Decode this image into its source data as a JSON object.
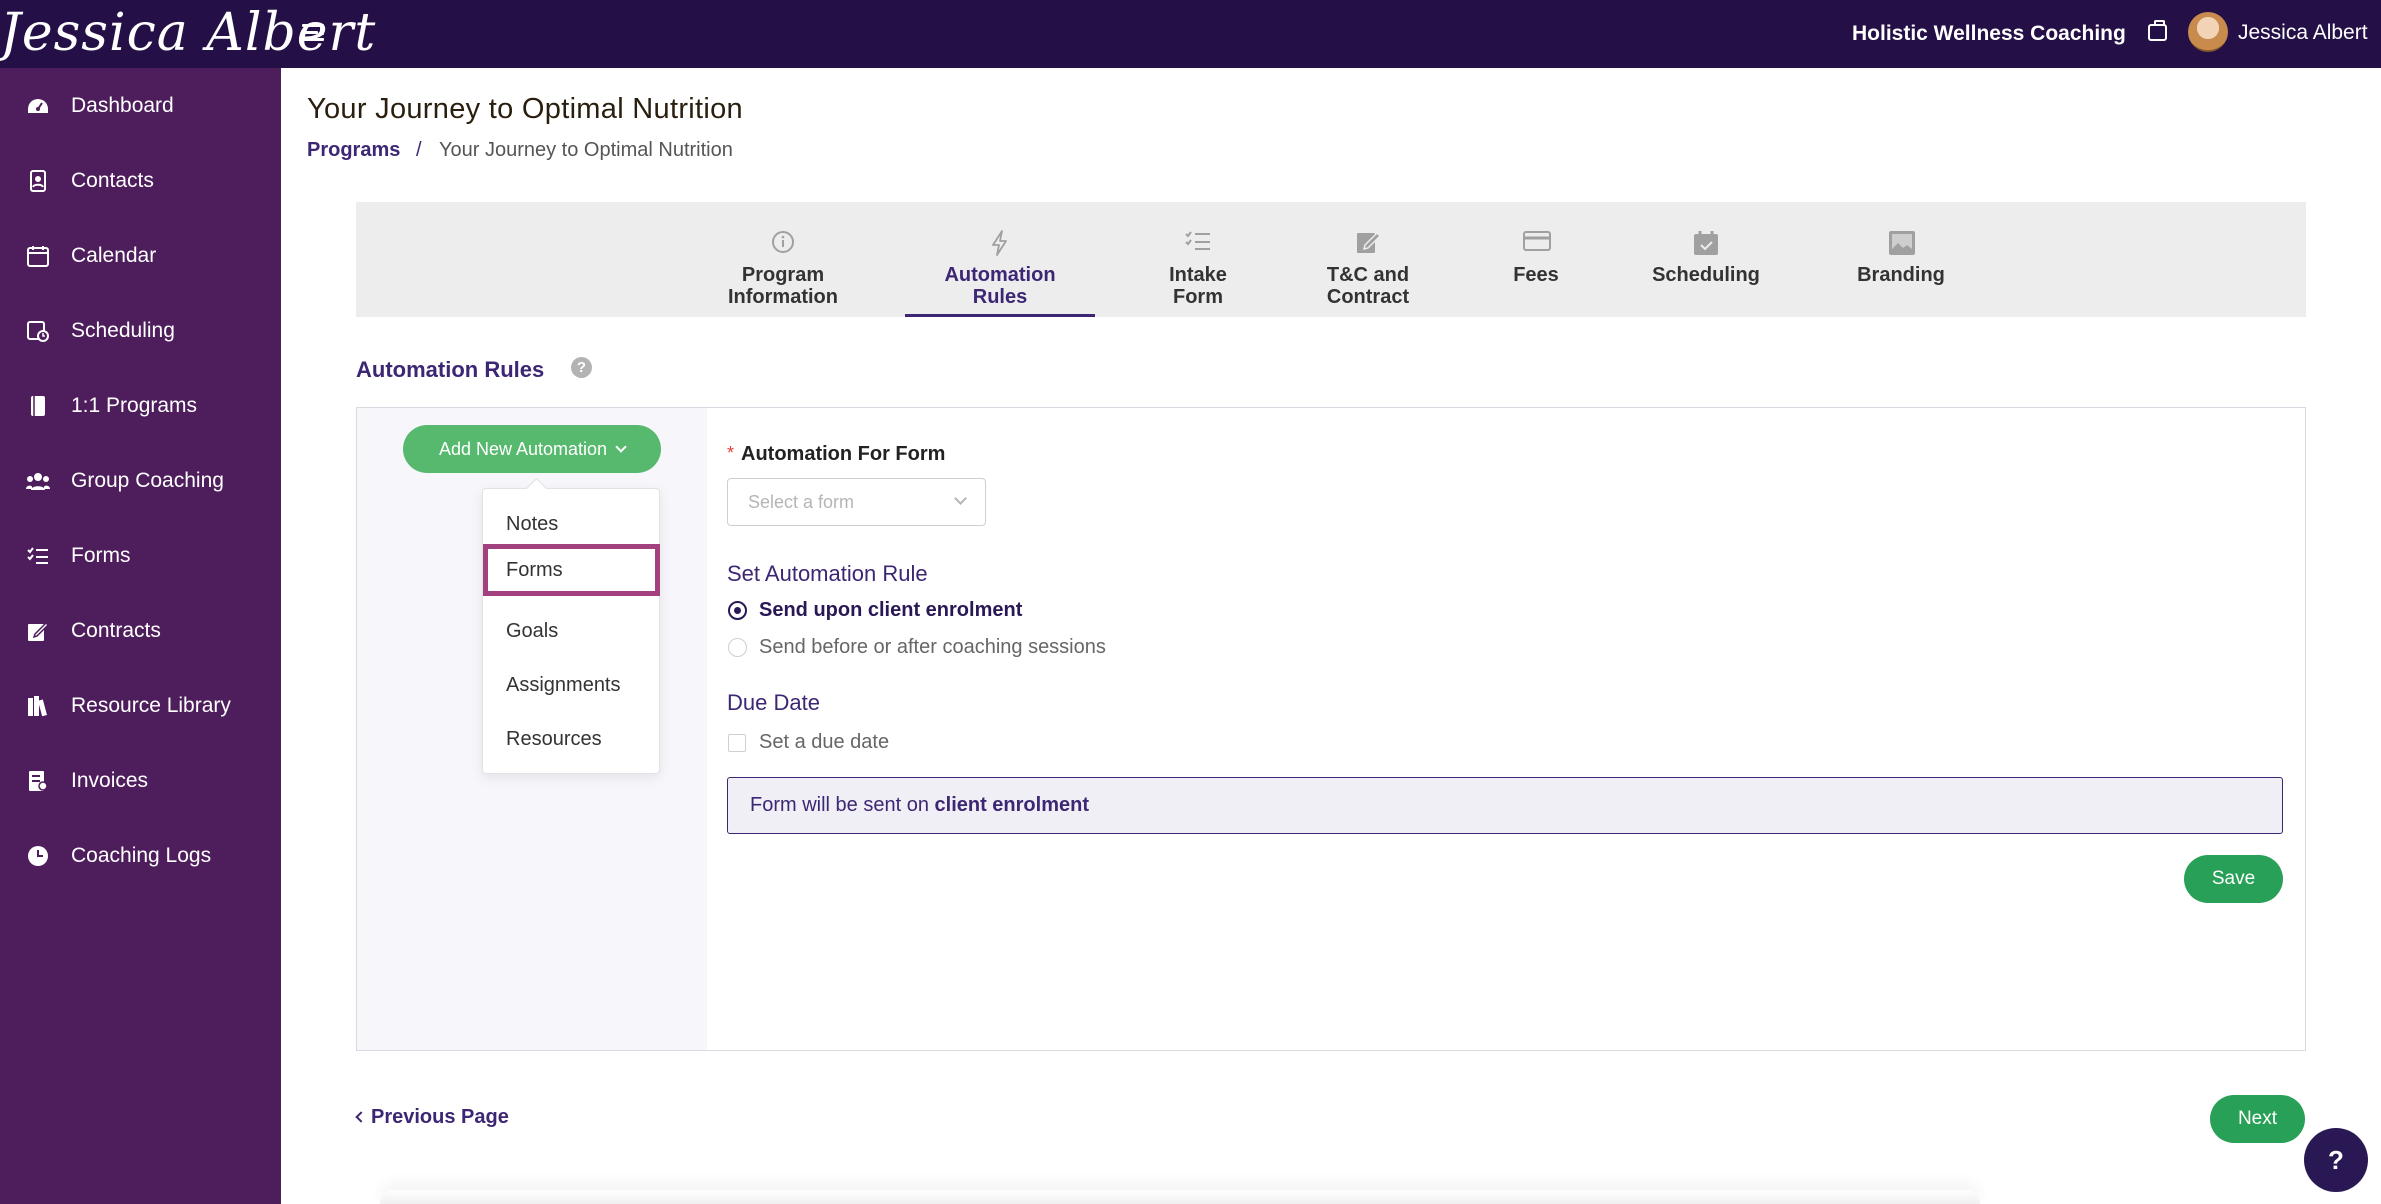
{
  "header": {
    "logo_text": "Jessica Albert",
    "org_name": "Holistic Wellness Coaching",
    "user_name": "Jessica Albert"
  },
  "sidebar": {
    "items": [
      {
        "label": "Dashboard",
        "icon": "dashboard-icon"
      },
      {
        "label": "Contacts",
        "icon": "contacts-icon"
      },
      {
        "label": "Calendar",
        "icon": "calendar-icon"
      },
      {
        "label": "Scheduling",
        "icon": "scheduling-icon"
      },
      {
        "label": "1:1 Programs",
        "icon": "book-icon"
      },
      {
        "label": "Group Coaching",
        "icon": "group-icon"
      },
      {
        "label": "Forms",
        "icon": "checklist-icon"
      },
      {
        "label": "Contracts",
        "icon": "signature-icon"
      },
      {
        "label": "Resource Library",
        "icon": "library-icon"
      },
      {
        "label": "Invoices",
        "icon": "invoice-icon"
      },
      {
        "label": "Coaching Logs",
        "icon": "clock-icon"
      }
    ]
  },
  "page": {
    "title": "Your Journey to Optimal Nutrition",
    "breadcrumb": {
      "parent": "Programs",
      "separator": "/",
      "current": "Your Journey to Optimal Nutrition"
    }
  },
  "tabs": [
    {
      "line1": "Program",
      "line2": "Information",
      "icon": "info-icon",
      "active": false
    },
    {
      "line1": "Automation",
      "line2": "Rules",
      "icon": "lightning-icon",
      "active": true
    },
    {
      "line1": "Intake",
      "line2": "Form",
      "icon": "checklist-icon",
      "active": false
    },
    {
      "line1": "T&C and",
      "line2": "Contract",
      "icon": "signature-icon",
      "active": false
    },
    {
      "line1": "Fees",
      "line2": "",
      "icon": "card-icon",
      "active": false
    },
    {
      "line1": "Scheduling",
      "line2": "",
      "icon": "calendar-check-icon",
      "active": false
    },
    {
      "line1": "Branding",
      "line2": "",
      "icon": "image-icon",
      "active": false
    }
  ],
  "automation": {
    "section_title": "Automation Rules",
    "help_glyph": "?",
    "add_button_label": "Add New Automation",
    "dropdown_items": [
      "Notes",
      "Forms",
      "Goals",
      "Assignments",
      "Resources"
    ],
    "selected_item": "Forms",
    "form_field_label": "Automation For Form",
    "required_marker": "*",
    "form_select_placeholder": "Select a form",
    "rule_heading": "Set Automation Rule",
    "rule_options": [
      {
        "label": "Send upon client enrolment",
        "checked": true
      },
      {
        "label": "Send before or after coaching sessions",
        "checked": false
      }
    ],
    "due_date_heading": "Due Date",
    "due_date_checkbox_label": "Set a due date",
    "due_date_checked": false,
    "summary_prefix": "Form will be sent on ",
    "summary_strong": "client enrolment",
    "save_label": "Save"
  },
  "footer": {
    "prev_label": "Previous Page",
    "next_label": "Next",
    "help_fab": "?"
  },
  "colors": {
    "topbar": "#241046",
    "sidebar": "#4e1d5c",
    "accent": "#3d2674",
    "green": "#28a057",
    "highlight": "#a3417f"
  }
}
